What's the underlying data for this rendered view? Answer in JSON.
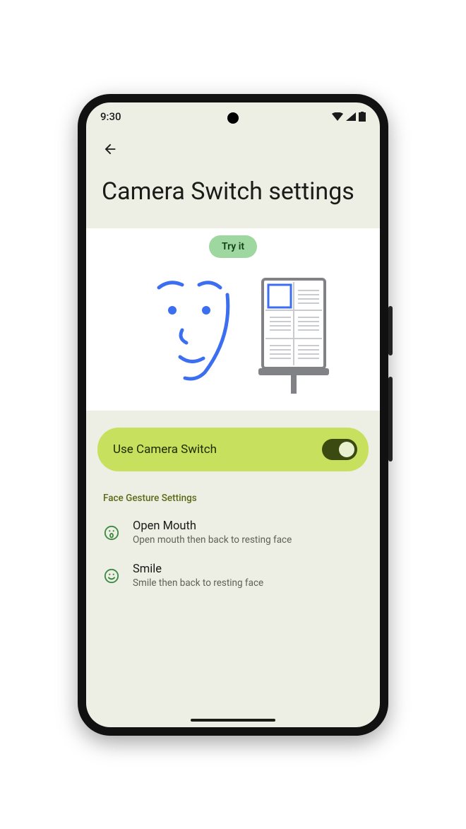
{
  "status": {
    "time": "9:30"
  },
  "page": {
    "title": "Camera Switch settings"
  },
  "hero": {
    "try_label": "Try it"
  },
  "toggle": {
    "label": "Use Camera Switch",
    "on": true
  },
  "section": {
    "label": "Face Gesture Settings"
  },
  "gestures": [
    {
      "title": "Open Mouth",
      "subtitle": "Open mouth then back to resting face"
    },
    {
      "title": "Smile",
      "subtitle": "Smile then back to resting face"
    }
  ]
}
